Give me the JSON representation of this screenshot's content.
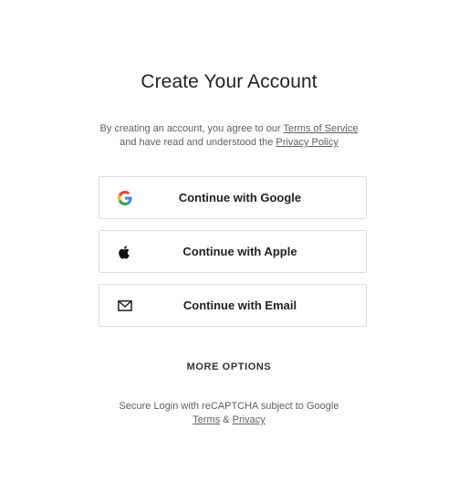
{
  "title": "Create Your Account",
  "agreement": {
    "line1_prefix": "By creating an account, you agree to our ",
    "terms_link": "Terms of Service",
    "line2_prefix": "and have read and understood the ",
    "privacy_link": "Privacy Policy"
  },
  "buttons": {
    "google": {
      "label": "Continue with Google",
      "icon": "google-icon"
    },
    "apple": {
      "label": "Continue with Apple",
      "icon": "apple-icon"
    },
    "email": {
      "label": "Continue with Email",
      "icon": "envelope-icon"
    }
  },
  "more_options": "MORE OPTIONS",
  "recaptcha": {
    "text": "Secure Login with reCAPTCHA subject to Google",
    "terms_link": "Terms",
    "separator": " & ",
    "privacy_link": "Privacy"
  },
  "colors": {
    "text": "#222222",
    "muted": "#5e5e5e",
    "border": "#dcdcdc",
    "google_blue": "#4285F4",
    "google_red": "#EA4335",
    "google_yellow": "#FBBC05",
    "google_green": "#34A853"
  }
}
